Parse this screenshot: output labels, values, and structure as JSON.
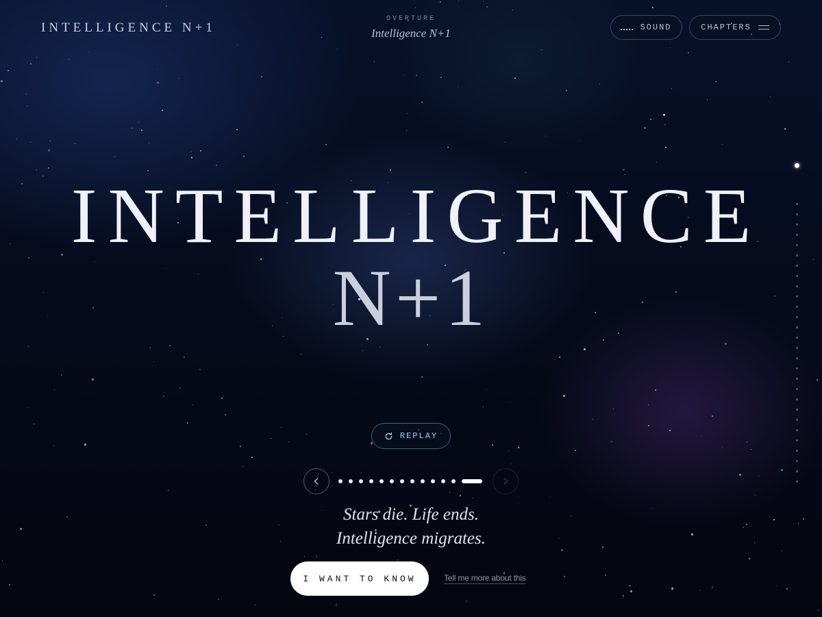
{
  "header": {
    "brand": "INTELLIGENCE N+1",
    "chapter_label": "OVERTURE",
    "chapter_title": "Intelligence N+1",
    "sound_label": "SOUND",
    "chapters_label": "CHAPTERS"
  },
  "hero": {
    "line1": "INTELLIGENCE",
    "line2": "N+1"
  },
  "replay": {
    "label": "REPLAY"
  },
  "carousel": {
    "slide_count": 13,
    "current_index": 12,
    "prev_enabled": true,
    "next_enabled": false
  },
  "scroll_rail": {
    "active_index": 0
  },
  "tagline": {
    "line1": "Stars die. Life ends.",
    "line2": "Intelligence migrates."
  },
  "cta": {
    "primary_label": "I WANT TO KNOW",
    "secondary_label": "Tell me more about this"
  },
  "colors": {
    "background": "#04070f",
    "accent": "#9fd1ee",
    "text": "#eef1f7"
  }
}
